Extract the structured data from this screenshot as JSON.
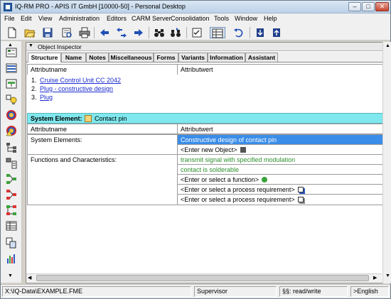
{
  "window": {
    "title": "IQ-RM PRO - APIS IT GmbH [10000-50] - Personal Desktop",
    "controls": {
      "minimize": "–",
      "maximize": "□",
      "close": "✕"
    }
  },
  "menubar": {
    "items": [
      "File",
      "Edit",
      "View",
      "Administration",
      "Editors",
      "CARM Server",
      "Consolidation",
      "Tools",
      "Window",
      "Help"
    ]
  },
  "toolbar": {
    "icons": [
      "new-document-icon",
      "open-folder-icon",
      "save-icon",
      "print-preview-icon",
      "print-icon",
      "arrow-left-icon",
      "arrow-split-icon",
      "arrow-right-icon",
      "binoculars-icon",
      "binoculars-next-icon",
      "checklist-icon",
      "grid-icon",
      "undo-icon",
      "export-icon",
      "import-icon"
    ]
  },
  "inspector": {
    "title": "Object Inspector",
    "tabs": [
      "Structure",
      "Name",
      "Notes",
      "Miscellaneous",
      "Forms",
      "Variants",
      "Information",
      "Assistant"
    ],
    "active_tab": "Structure",
    "columns": {
      "name": "Attributname",
      "value": "Attributwert"
    },
    "path": [
      {
        "num": "1.",
        "label": "Cruise Control Unit CC 2042"
      },
      {
        "num": "2.",
        "label": "Plug - constructive design"
      },
      {
        "num": "3.",
        "label": "Plug"
      }
    ],
    "system_element": {
      "label": "System Element:",
      "name": "Contact pin"
    },
    "rows": {
      "system_elements_label": "System Elements:",
      "system_elements_values": [
        "Constructive design of contact pin",
        "<Enter new Object>"
      ],
      "functions_label": "Functions and Characteristics:",
      "functions_values": [
        "transmit signal with specified modulation",
        "contact is solderable",
        "<Enter or select a function>",
        "<Enter or select a process requirement>",
        "<Enter or select a process requirement>"
      ]
    }
  },
  "colors": {
    "system_header_bg": "#7fe8ee",
    "selected_bg": "#3a8de8",
    "function_text": "#2d8f2d",
    "link_text": "#1a2bd0"
  },
  "statusbar": {
    "path": "X:\\IQ-Data\\EXAMPLE.FME",
    "user": "Supervisor",
    "rights": "§§: read/write",
    "language": ">English"
  }
}
